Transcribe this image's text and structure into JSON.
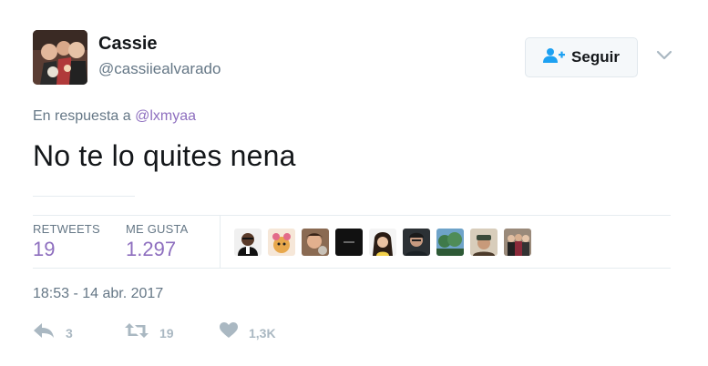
{
  "user": {
    "name": "Cassie",
    "handle": "@cassiiealvarado"
  },
  "follow_button": {
    "label": "Seguir"
  },
  "tweet": {
    "reply_prefix": "En respuesta a",
    "reply_handle": "@lxmyaa",
    "text": "No te lo quites nena",
    "timestamp": "18:53 - 14 abr. 2017"
  },
  "stats": {
    "retweets_label": "RETWEETS",
    "retweets_value": "19",
    "likes_label": "ME GUSTA",
    "likes_value": "1.297"
  },
  "actions": {
    "reply_count": "3",
    "retweet_count": "19",
    "like_count": "1,3K"
  },
  "colors": {
    "link": "#8e6fbf",
    "muted": "#657786",
    "action_icon": "#aab8c2",
    "follow_icon": "#1da1f2"
  },
  "icons": [
    "follow-user-icon",
    "chevron-down-icon",
    "reply-icon",
    "retweet-icon",
    "heart-icon"
  ]
}
